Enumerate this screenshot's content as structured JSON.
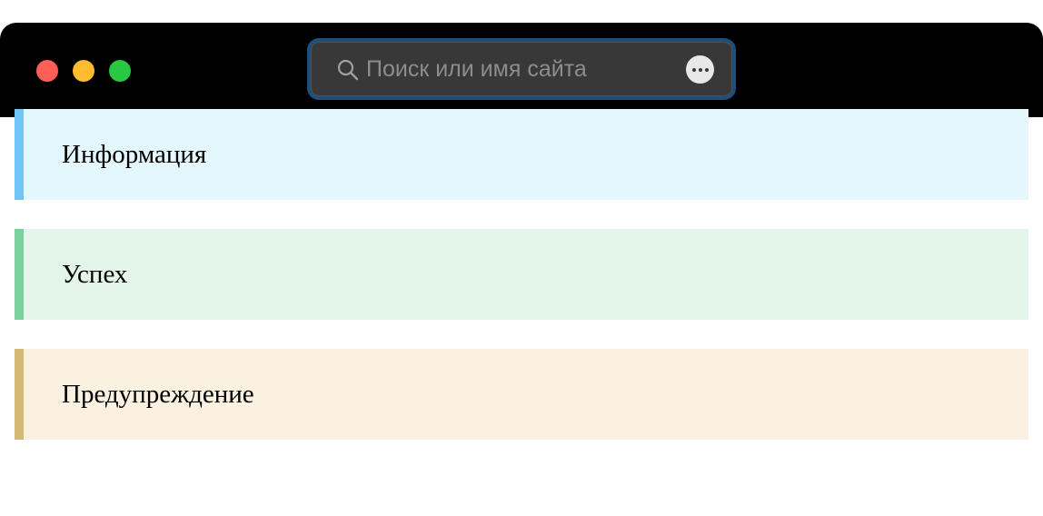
{
  "browser": {
    "address_bar": {
      "placeholder": "Поиск или имя сайта",
      "value": ""
    },
    "icons": {
      "search": "search-icon",
      "more": "ellipsis-icon"
    },
    "traffic_lights": {
      "close": "#ff5f57",
      "minimize": "#febc2e",
      "maximize": "#28c840"
    }
  },
  "alerts": [
    {
      "type": "info",
      "text": "Информация",
      "background": "#e3f7fd",
      "border": "#70c5f7"
    },
    {
      "type": "success",
      "text": "Успех",
      "background": "#e3f6e9",
      "border": "#7ccf9f"
    },
    {
      "type": "warning",
      "text": "Предупреждение",
      "background": "#faf1e0",
      "border": "#d4b876"
    }
  ]
}
